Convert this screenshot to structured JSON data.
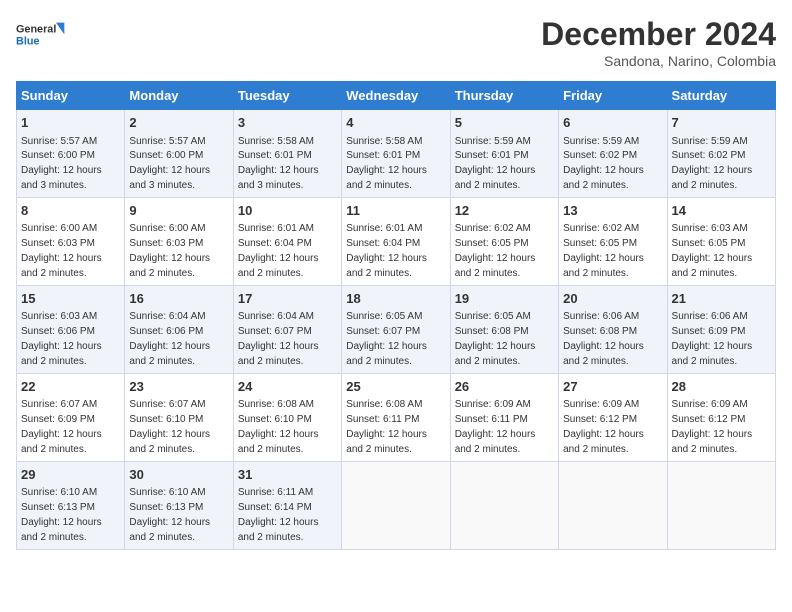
{
  "logo": {
    "line1": "General",
    "line2": "Blue"
  },
  "title": "December 2024",
  "location": "Sandona, Narino, Colombia",
  "headers": [
    "Sunday",
    "Monday",
    "Tuesday",
    "Wednesday",
    "Thursday",
    "Friday",
    "Saturday"
  ],
  "weeks": [
    [
      {
        "day": "1",
        "info": "Sunrise: 5:57 AM\nSunset: 6:00 PM\nDaylight: 12 hours and 3 minutes."
      },
      {
        "day": "2",
        "info": "Sunrise: 5:57 AM\nSunset: 6:00 PM\nDaylight: 12 hours and 3 minutes."
      },
      {
        "day": "3",
        "info": "Sunrise: 5:58 AM\nSunset: 6:01 PM\nDaylight: 12 hours and 3 minutes."
      },
      {
        "day": "4",
        "info": "Sunrise: 5:58 AM\nSunset: 6:01 PM\nDaylight: 12 hours and 2 minutes."
      },
      {
        "day": "5",
        "info": "Sunrise: 5:59 AM\nSunset: 6:01 PM\nDaylight: 12 hours and 2 minutes."
      },
      {
        "day": "6",
        "info": "Sunrise: 5:59 AM\nSunset: 6:02 PM\nDaylight: 12 hours and 2 minutes."
      },
      {
        "day": "7",
        "info": "Sunrise: 5:59 AM\nSunset: 6:02 PM\nDaylight: 12 hours and 2 minutes."
      }
    ],
    [
      {
        "day": "8",
        "info": "Sunrise: 6:00 AM\nSunset: 6:03 PM\nDaylight: 12 hours and 2 minutes."
      },
      {
        "day": "9",
        "info": "Sunrise: 6:00 AM\nSunset: 6:03 PM\nDaylight: 12 hours and 2 minutes."
      },
      {
        "day": "10",
        "info": "Sunrise: 6:01 AM\nSunset: 6:04 PM\nDaylight: 12 hours and 2 minutes."
      },
      {
        "day": "11",
        "info": "Sunrise: 6:01 AM\nSunset: 6:04 PM\nDaylight: 12 hours and 2 minutes."
      },
      {
        "day": "12",
        "info": "Sunrise: 6:02 AM\nSunset: 6:05 PM\nDaylight: 12 hours and 2 minutes."
      },
      {
        "day": "13",
        "info": "Sunrise: 6:02 AM\nSunset: 6:05 PM\nDaylight: 12 hours and 2 minutes."
      },
      {
        "day": "14",
        "info": "Sunrise: 6:03 AM\nSunset: 6:05 PM\nDaylight: 12 hours and 2 minutes."
      }
    ],
    [
      {
        "day": "15",
        "info": "Sunrise: 6:03 AM\nSunset: 6:06 PM\nDaylight: 12 hours and 2 minutes."
      },
      {
        "day": "16",
        "info": "Sunrise: 6:04 AM\nSunset: 6:06 PM\nDaylight: 12 hours and 2 minutes."
      },
      {
        "day": "17",
        "info": "Sunrise: 6:04 AM\nSunset: 6:07 PM\nDaylight: 12 hours and 2 minutes."
      },
      {
        "day": "18",
        "info": "Sunrise: 6:05 AM\nSunset: 6:07 PM\nDaylight: 12 hours and 2 minutes."
      },
      {
        "day": "19",
        "info": "Sunrise: 6:05 AM\nSunset: 6:08 PM\nDaylight: 12 hours and 2 minutes."
      },
      {
        "day": "20",
        "info": "Sunrise: 6:06 AM\nSunset: 6:08 PM\nDaylight: 12 hours and 2 minutes."
      },
      {
        "day": "21",
        "info": "Sunrise: 6:06 AM\nSunset: 6:09 PM\nDaylight: 12 hours and 2 minutes."
      }
    ],
    [
      {
        "day": "22",
        "info": "Sunrise: 6:07 AM\nSunset: 6:09 PM\nDaylight: 12 hours and 2 minutes."
      },
      {
        "day": "23",
        "info": "Sunrise: 6:07 AM\nSunset: 6:10 PM\nDaylight: 12 hours and 2 minutes."
      },
      {
        "day": "24",
        "info": "Sunrise: 6:08 AM\nSunset: 6:10 PM\nDaylight: 12 hours and 2 minutes."
      },
      {
        "day": "25",
        "info": "Sunrise: 6:08 AM\nSunset: 6:11 PM\nDaylight: 12 hours and 2 minutes."
      },
      {
        "day": "26",
        "info": "Sunrise: 6:09 AM\nSunset: 6:11 PM\nDaylight: 12 hours and 2 minutes."
      },
      {
        "day": "27",
        "info": "Sunrise: 6:09 AM\nSunset: 6:12 PM\nDaylight: 12 hours and 2 minutes."
      },
      {
        "day": "28",
        "info": "Sunrise: 6:09 AM\nSunset: 6:12 PM\nDaylight: 12 hours and 2 minutes."
      }
    ],
    [
      {
        "day": "29",
        "info": "Sunrise: 6:10 AM\nSunset: 6:13 PM\nDaylight: 12 hours and 2 minutes."
      },
      {
        "day": "30",
        "info": "Sunrise: 6:10 AM\nSunset: 6:13 PM\nDaylight: 12 hours and 2 minutes."
      },
      {
        "day": "31",
        "info": "Sunrise: 6:11 AM\nSunset: 6:14 PM\nDaylight: 12 hours and 2 minutes."
      },
      null,
      null,
      null,
      null
    ]
  ]
}
